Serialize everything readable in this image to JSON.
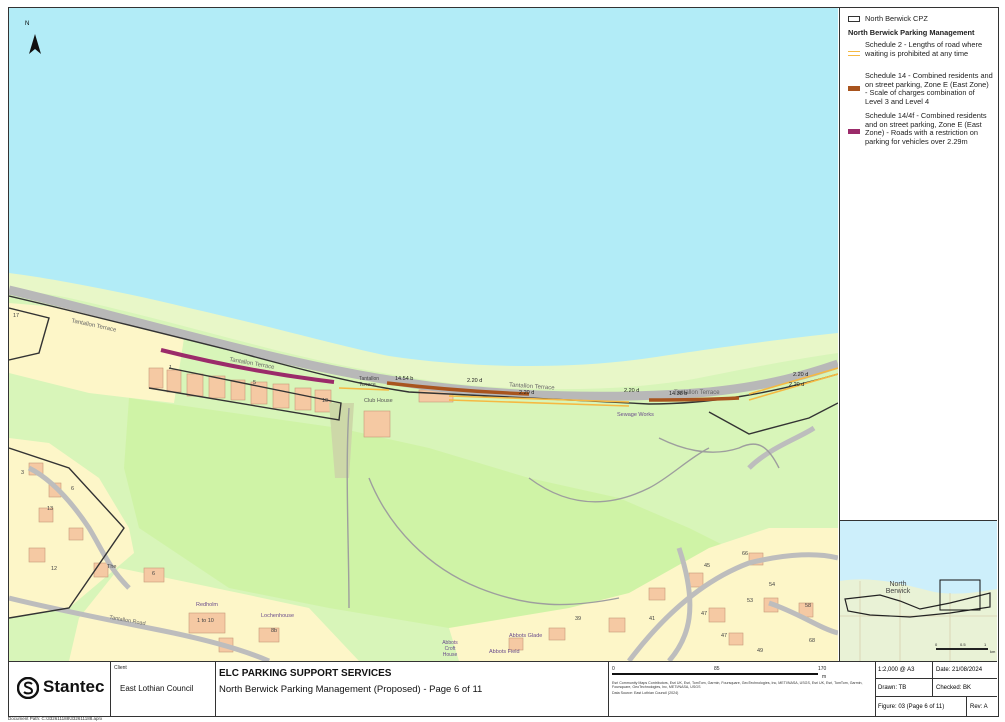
{
  "map": {
    "north_label": "N",
    "road_labels": [
      "Tantallon Terrace",
      "Tantallon Terrace",
      "Tantallon Terrace",
      "Tantallon Terrace",
      "Tantallon Terrace",
      "Tantallon Terrace",
      "Tantallon Road"
    ],
    "road_label_main": "Tantallon Terrace",
    "road_label_east": "Tantallon Road",
    "places": {
      "club_house": "Club House",
      "sewage_works": "Sewage Works",
      "redholm": "Redholm",
      "lochenhouse": "Lochenhouse",
      "abbots_croft_house": "Abbots Croft House",
      "abbots_glade": "Abbots Glade",
      "abbots_field": "Abbots Field",
      "tantallon_terrace_small": "Tantallon Terrace"
    },
    "house_numbers": [
      "17",
      "1",
      "5",
      "10",
      "3",
      "6",
      "13",
      "12",
      "6",
      "11",
      "66",
      "45",
      "54",
      "53",
      "47",
      "58",
      "41",
      "47",
      "49",
      "68",
      "39",
      "1 to 10",
      "8b",
      "The"
    ],
    "lengths": [
      "2.20 d",
      "14.54 b",
      "2.20 d",
      "2.20 d",
      "2.20 d",
      "2.20 d",
      "14.38 b",
      "2.20 d",
      "2.20 d"
    ]
  },
  "legend": {
    "cpz_label": "North Berwick CPZ",
    "heading": "North Berwick Parking Management",
    "items": [
      {
        "label": "Schedule 2 - Lengths of road where waiting is prohibited at any time",
        "color": "#f5b942"
      },
      {
        "label": "Schedule 14 - Combined residents and on street parking, Zone E (East Zone) - Scale of charges combination of Level 3 and Level 4",
        "color": "#a8541e"
      },
      {
        "label": "Schedule 14/4f - Combined residents and on street parking, Zone E (East Zone) - Roads with a restriction on parking for vehicles over 2.29m",
        "color": "#9b2b6a"
      }
    ]
  },
  "inset": {
    "label": "North Berwick"
  },
  "titleblock": {
    "logo_text": "Stantec",
    "client_label": "Client",
    "client_name": "East Lothian Council",
    "project_title": "ELC PARKING SUPPORT SERVICES",
    "subtitle": "North Berwick Parking Management (Proposed) - Page 6 of 11",
    "scale_bar": [
      "0",
      "85",
      "170"
    ],
    "scale_units": "m",
    "attribution": "Esri Community Maps Contributors, Esri UK, Esri, TomTom, Garmin, Foursquare, GeoTechnologies, Inc, METI/NASA, USGS, Esri UK, Esri, TomTom, Garmin, Foursquare, GeoTechnologies, Inc, METI/NASA, USGS",
    "data_source": "Data Source: East Lothian Council (2024)",
    "scale": "1:2,000 @ A3",
    "date": "Date: 21/08/2024",
    "drawn": "Drawn: TB",
    "checked": "Checked: BK",
    "figure": "Figure: 03 (Page 6 of 11)",
    "rev": "Rev: A"
  },
  "inset_scale": [
    "0",
    "0.5",
    "1",
    "km"
  ],
  "document_path": "Document Path: C:\\332611188\\332611188.aprx"
}
